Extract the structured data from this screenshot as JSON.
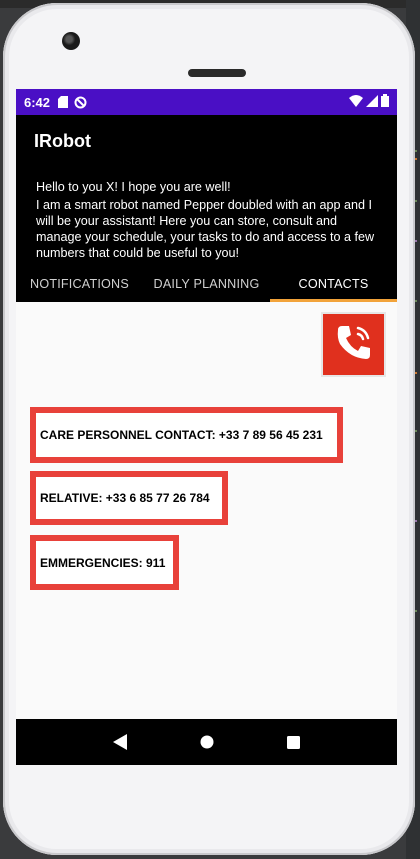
{
  "status_bar": {
    "time": "6:42",
    "icons": [
      "sd-card-icon",
      "no-disturb-icon",
      "wifi-icon",
      "signal-icon",
      "battery-icon"
    ],
    "color": "#4a0fc5"
  },
  "app": {
    "title": "IRobot",
    "greeting": "Hello to you X! I hope you are well!",
    "description": "I am a smart robot named Pepper doubled with an app and I will be your assistant! Here you can store, consult and manage your schedule, your tasks to do and access to a few numbers that could be useful to you!"
  },
  "tabs": [
    {
      "label": "NOTIFICATIONS",
      "active": false
    },
    {
      "label": "DAILY PLANNING",
      "active": false
    },
    {
      "label": "CONTACTS",
      "active": true
    }
  ],
  "contacts": [
    {
      "text": "CARE PERSONNEL CONTACT: +33 7 89 56 45 231"
    },
    {
      "text": "RELATIVE: +33 6 85 77 26 784"
    },
    {
      "text": "EMMERGENCIES: 911"
    }
  ],
  "colors": {
    "accent_tab": "#f2a33a",
    "card_border": "#e8413a",
    "call_button": "#e0301e",
    "header_bg": "#000000"
  },
  "nav": [
    "back-icon",
    "home-icon",
    "recents-icon"
  ]
}
